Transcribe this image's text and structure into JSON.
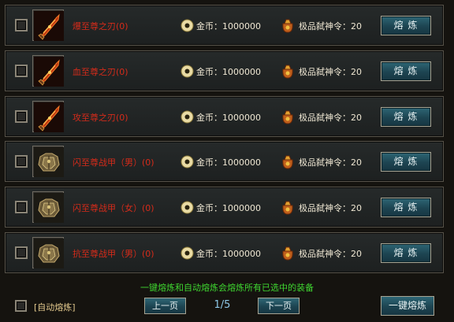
{
  "rows": [
    {
      "name": "爆至尊之刃(0)",
      "item_type": "sword-icon",
      "gold": "金币：1000000",
      "token": "极品弑神令：20",
      "button": "熔 炼"
    },
    {
      "name": "血至尊之刃(0)",
      "item_type": "sword-icon",
      "gold": "金币：1000000",
      "token": "极品弑神令：20",
      "button": "熔 炼"
    },
    {
      "name": "攻至尊之刃(0)",
      "item_type": "sword-icon",
      "gold": "金币：1000000",
      "token": "极品弑神令：20",
      "button": "熔 炼"
    },
    {
      "name": "闪至尊战甲（男）(0)",
      "item_type": "armor-icon",
      "gold": "金币：1000000",
      "token": "极品弑神令：20",
      "button": "熔 炼"
    },
    {
      "name": "闪至尊战甲（女）(0)",
      "item_type": "armor-icon",
      "gold": "金币：1000000",
      "token": "极品弑神令：20",
      "button": "熔 炼"
    },
    {
      "name": "抗至尊战甲（男）(0)",
      "item_type": "armor-icon",
      "gold": "金币：1000000",
      "token": "极品弑神令：20",
      "button": "熔 炼"
    }
  ],
  "footer": {
    "hint": "一键熔炼和自动熔炼会熔炼所有已选中的装备",
    "auto_label": "[自动熔炼]",
    "prev": "上一页",
    "page": "1/5",
    "next": "下一页",
    "smelt_all": "一键熔炼"
  },
  "colors": {
    "item_name": "#d62b1a",
    "hint": "#3fd630",
    "button": "#1d4451",
    "page": "#8ec8e8"
  }
}
